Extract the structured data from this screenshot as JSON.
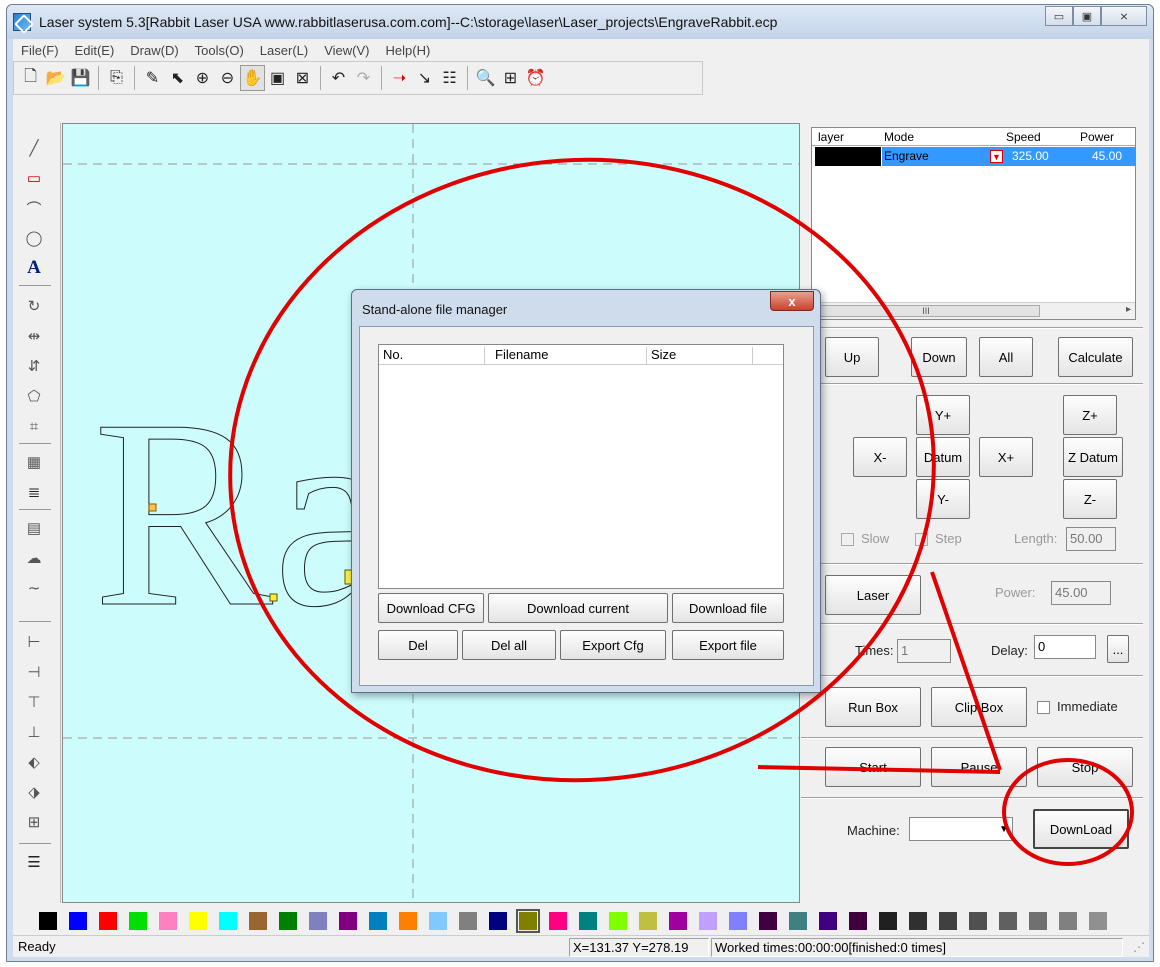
{
  "window": {
    "title": "Laser system 5.3[Rabbit Laser USA www.rabbitlaserusa.com.com]--C:\\storage\\laser\\Laser_projects\\EngraveRabbit.ecp",
    "minimize": "▭",
    "maximize": "▣",
    "close": "⨯"
  },
  "menu": [
    "File(F)",
    "Edit(E)",
    "Draw(D)",
    "Tools(O)",
    "Laser(L)",
    "View(V)",
    "Help(H)"
  ],
  "toolbar_icons": [
    "new-file-icon",
    "open-folder-icon",
    "save-icon",
    "import-icon",
    "clean-brush-icon",
    "select-node-icon",
    "zoom-in-icon",
    "zoom-out-icon",
    "pan-hand-icon",
    "page-view-icon",
    "fit-view-icon",
    "undo-icon",
    "redo-icon",
    "cut-path-icon",
    "line-order-icon",
    "array-icon",
    "preview-icon",
    "path-optimize-icon",
    "timer-icon"
  ],
  "canvas": {
    "text": "Ra"
  },
  "layers": {
    "headers": {
      "layer": "layer",
      "mode": "Mode",
      "speed": "Speed",
      "power": "Power"
    },
    "rows": [
      {
        "color": "#000000",
        "mode": "Engrave",
        "speed": "325.00",
        "power": "45.00"
      }
    ],
    "scroll_thumb": "III"
  },
  "controls": {
    "up": "Up",
    "down": "Down",
    "all": "All",
    "calculate": "Calculate",
    "y_plus": "Y+",
    "z_plus": "Z+",
    "x_minus": "X-",
    "datum": "Datum",
    "x_plus": "X+",
    "z_datum": "Z Datum",
    "y_minus": "Y-",
    "z_minus": "Z-",
    "slow": "Slow",
    "step": "Step",
    "length_label": "Length:",
    "length_value": "50.00",
    "laser": "Laser",
    "power_label": "Power:",
    "power_value": "45.00",
    "times_label": "Times:",
    "times_value": "1",
    "delay_label": "Delay:",
    "delay_value": "0",
    "ellipsis": "...",
    "run_box": "Run Box",
    "clip_box": "Clip Box",
    "immediate": "Immediate",
    "start": "Start",
    "pause": "Pause",
    "stop": "Stop",
    "machine_label": "Machine:",
    "machine_value": "",
    "download": "DownLoad"
  },
  "dialog": {
    "title": "Stand-alone file manager",
    "close": "x",
    "columns": [
      "No.",
      "Filename",
      "Size"
    ],
    "buttons_row1": [
      "Download CFG",
      "Download current",
      "Download file"
    ],
    "buttons_row2": [
      "Del",
      "Del all",
      "Export Cfg",
      "Export file"
    ]
  },
  "palette": [
    "#000000",
    "#0000ff",
    "#ff0000",
    "#00e000",
    "#ff80c0",
    "#ffff00",
    "#00ffff",
    "#996633",
    "#008000",
    "#8080c0",
    "#800080",
    "#0080c0",
    "#ff8000",
    "#80c8ff",
    "#808080",
    "#000080",
    "#808000",
    "#ff0080",
    "#008080",
    "#80ff00",
    "#c0c040",
    "#a000a0",
    "#c0a0ff",
    "#8080ff",
    "#400040",
    "#408080",
    "#400080",
    "#400040",
    "#202020",
    "#303030",
    "#404040",
    "#505050",
    "#606060",
    "#707070",
    "#808080",
    "#909090"
  ],
  "status": {
    "ready": "Ready",
    "coords": "X=131.37 Y=278.19",
    "worked": "Worked times:00:00:00[finished:0 times]"
  }
}
